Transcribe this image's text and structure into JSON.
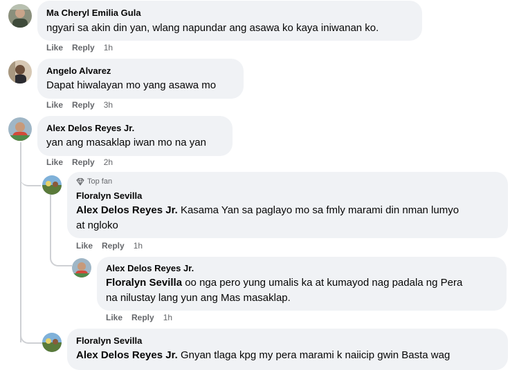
{
  "comments": [
    {
      "author": "Ma Cheryl Emilia Gula",
      "text": "ngyari sa akin din yan, wlang napundar ang asawa ko kaya iniwanan ko.",
      "like": "Like",
      "reply": "Reply",
      "time": "1h"
    },
    {
      "author": "Angelo Alvarez",
      "text": "Dapat hiwalayan mo yang asawa mo",
      "like": "Like",
      "reply": "Reply",
      "time": "3h"
    },
    {
      "author": "Alex Delos Reyes Jr.",
      "text": "yan ang masaklap iwan mo na yan",
      "like": "Like",
      "reply": "Reply",
      "time": "2h"
    }
  ],
  "replies": [
    {
      "badge": "Top fan",
      "author": "Floralyn Sevilla",
      "tag": "Alex Delos Reyes Jr.",
      "line1": "Kasama Yan sa paglayo mo sa fmly marami din nman lumyo",
      "line2": "at ngloko",
      "like": "Like",
      "reply": "Reply",
      "time": "1h"
    },
    {
      "author": "Alex Delos Reyes Jr.",
      "tag": "Floralyn Sevilla",
      "line1": "oo nga pero yung umalis ka at kumayod nag padala ng Pera",
      "line2": "na nilustay lang yun ang Mas masaklap.",
      "like": "Like",
      "reply": "Reply",
      "time": "1h"
    },
    {
      "author": "Floralyn Sevilla",
      "tag": "Alex Delos Reyes Jr.",
      "line1": "Gnyan tlaga kpg my pera marami k naiicip gwin Basta wag"
    }
  ],
  "icons": {
    "top_fan": "diamond-icon"
  },
  "colors": {
    "bubble": "#f0f2f5",
    "meta": "#65676b",
    "thread_line": "#ced0d4",
    "text": "#050505"
  }
}
